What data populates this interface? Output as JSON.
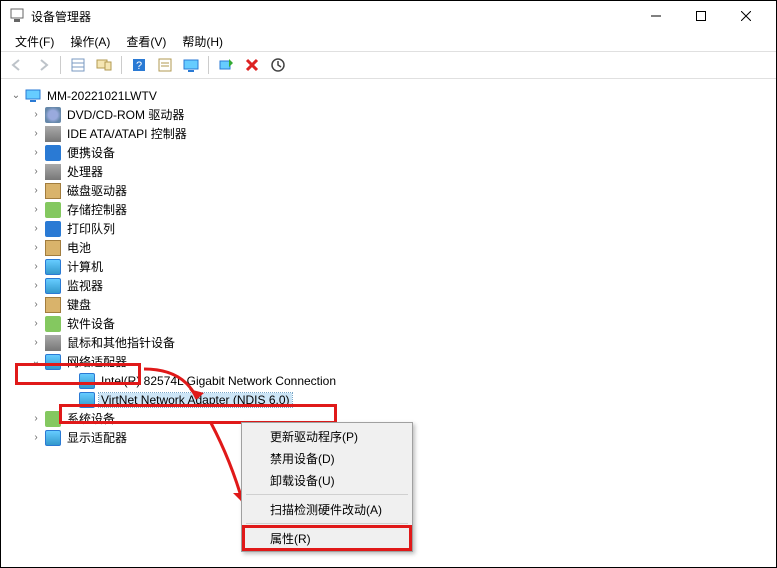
{
  "window": {
    "title": "设备管理器",
    "controls": {
      "min": "–",
      "max": "▢",
      "close": "✕"
    }
  },
  "menubar": [
    {
      "label": "文件(F)"
    },
    {
      "label": "操作(A)"
    },
    {
      "label": "查看(V)"
    },
    {
      "label": "帮助(H)"
    }
  ],
  "tree": {
    "root": {
      "label": "MM-20221021LWTV",
      "expanded": true
    },
    "items": [
      {
        "label": "DVD/CD-ROM 驱动器",
        "icon": "disc"
      },
      {
        "label": "IDE ATA/ATAPI 控制器",
        "icon": "chip"
      },
      {
        "label": "便携设备",
        "icon": "blue"
      },
      {
        "label": "处理器",
        "icon": "chip"
      },
      {
        "label": "磁盘驱动器",
        "icon": "box"
      },
      {
        "label": "存储控制器",
        "icon": "gear"
      },
      {
        "label": "打印队列",
        "icon": "blue"
      },
      {
        "label": "电池",
        "icon": "box"
      },
      {
        "label": "计算机",
        "icon": "mon"
      },
      {
        "label": "监视器",
        "icon": "mon"
      },
      {
        "label": "键盘",
        "icon": "box"
      },
      {
        "label": "软件设备",
        "icon": "gear"
      },
      {
        "label": "鼠标和其他指针设备",
        "icon": "chip"
      }
    ],
    "netadapter": {
      "label": "网络适配器",
      "expanded": true,
      "children": [
        {
          "label": "Intel(R) 82574L Gigabit Network Connection",
          "selected": false
        },
        {
          "label": "VirtNet Network Adapter (NDIS 6.0)",
          "selected": true
        }
      ]
    },
    "after": [
      {
        "label": "系统设备",
        "icon": "gear"
      },
      {
        "label": "显示适配器",
        "icon": "mon"
      }
    ]
  },
  "context_menu": [
    {
      "label": "更新驱动程序(P)"
    },
    {
      "label": "禁用设备(D)"
    },
    {
      "label": "卸载设备(U)"
    },
    {
      "sep": true
    },
    {
      "label": "扫描检测硬件改动(A)"
    },
    {
      "sep": true
    },
    {
      "label": "属性(R)",
      "highlight": true
    }
  ],
  "toolbar_icons": [
    "back",
    "forward",
    "list",
    "home",
    "help",
    "props",
    "monitor",
    "scan",
    "remove",
    "update"
  ]
}
